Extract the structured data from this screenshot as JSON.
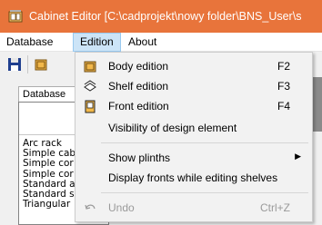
{
  "window": {
    "title": "Cabinet Editor [C:\\cadprojekt\\nowy folder\\BNS_User\\s",
    "accent_color": "#e8743b"
  },
  "menubar": {
    "items": [
      {
        "label": "Database"
      },
      {
        "label": "Edition"
      },
      {
        "label": "About"
      }
    ]
  },
  "left_panel": {
    "tab_label": "Database",
    "list": [
      "Arc rack",
      "Simple cab",
      "Simple cor",
      "Simple cor",
      "Standard a",
      "Standard s",
      "Triangular"
    ]
  },
  "dropdown": {
    "items": [
      {
        "label": "Body edition",
        "shortcut": "F2",
        "icon": "body-edition-icon"
      },
      {
        "label": "Shelf edition",
        "shortcut": "F3",
        "icon": "shelf-edition-icon"
      },
      {
        "label": "Front edition",
        "shortcut": "F4",
        "icon": "front-edition-icon"
      },
      {
        "label": "Visibility of design element"
      },
      {
        "label": "Show plinths",
        "submenu": true
      },
      {
        "label": "Display fronts while editing shelves"
      },
      {
        "label": "Undo",
        "shortcut": "Ctrl+Z",
        "disabled": true,
        "icon": "undo-icon"
      }
    ]
  }
}
